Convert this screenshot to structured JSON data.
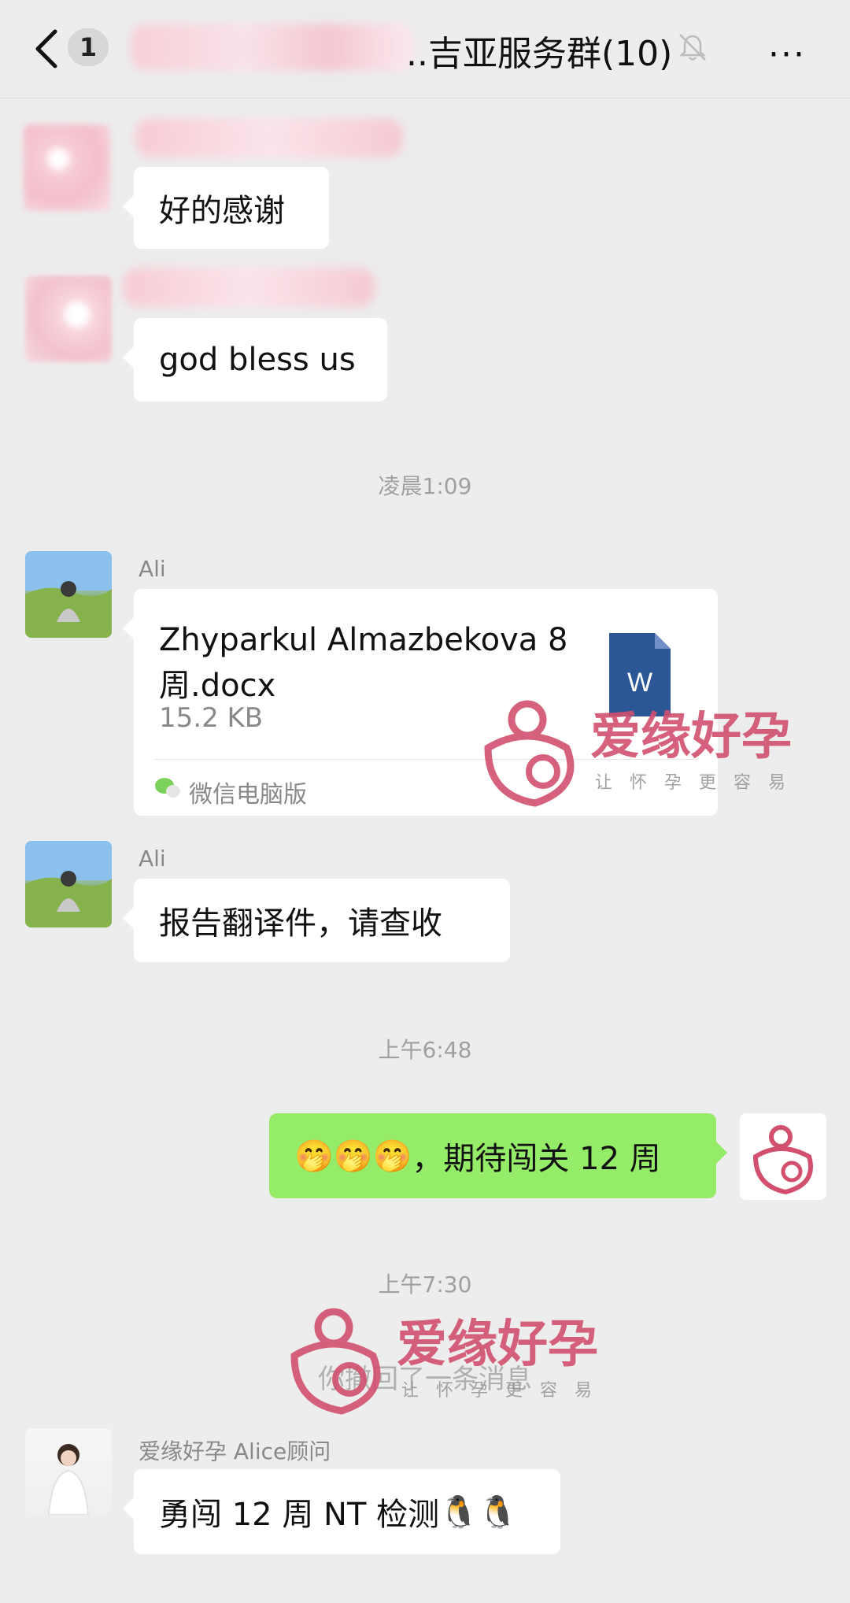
{
  "header": {
    "unread_count": "1",
    "title": "..吉亚服务群(10)",
    "more_label": "···"
  },
  "messages": {
    "m1_text": "好的感谢",
    "m2_text": "god bless us",
    "time1": "凌晨1:09",
    "ali_name": "Ali",
    "file": {
      "name": "Zhyparkul Almazbekova 8 周.docx",
      "size": "15.2 KB",
      "source": "微信电脑版",
      "icon_letter": "W"
    },
    "ali_name_2": "Ali",
    "m4_text": "报告翻译件，请查收",
    "time2": "上午6:48",
    "mine_emoji": "🤭🤭🤭",
    "mine_text": "，期待闯关 12 周",
    "time3": "上午7:30",
    "recalled": "你撤回了一条消息",
    "alice_name": "爱缘好孕 Alice顾问",
    "alice_text": "勇闯 12 周 NT 检测",
    "alice_emoji": "🐧🐧"
  },
  "watermark": {
    "brand": "爱缘好孕",
    "slogan": "让怀孕更容易"
  },
  "colors": {
    "background": "#ededed",
    "mine_bubble": "#95ec69",
    "brand_pink": "#d2506e",
    "word_blue": "#2b5797"
  }
}
